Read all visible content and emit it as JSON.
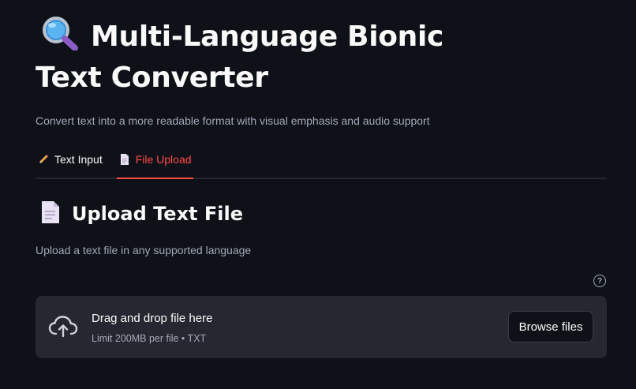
{
  "header": {
    "title_line1": "Multi-Language Bionic",
    "title_line2": "Text Converter",
    "title_icon": "magnifying-glass-icon",
    "subtitle": "Convert text into a more readable format with visual emphasis and audio support"
  },
  "tabs": [
    {
      "label": "Text Input",
      "icon": "pencil-icon",
      "active": false
    },
    {
      "label": "File Upload",
      "icon": "document-icon",
      "active": true
    }
  ],
  "section": {
    "title": "Upload Text File",
    "icon": "document-icon",
    "description": "Upload a text file in any supported language"
  },
  "uploader": {
    "help_icon": "question-circle-icon",
    "upload_icon": "cloud-upload-icon",
    "drop_title": "Drag and drop file here",
    "limit_text": "Limit 200MB per file • TXT",
    "browse_label": "Browse files"
  },
  "colors": {
    "background": "#0e1117",
    "text": "#fafafa",
    "muted_text": "#a3a8b8",
    "accent": "#ff4b4b",
    "dropzone_bg": "#262730"
  }
}
